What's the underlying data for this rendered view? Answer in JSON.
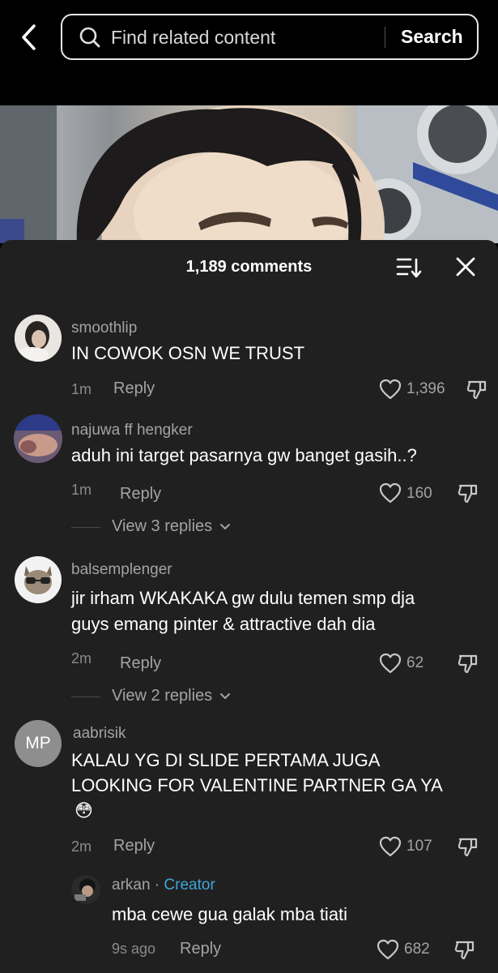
{
  "search": {
    "placeholder": "Find related content",
    "button": "Search"
  },
  "icons": {
    "back": "chevron-left-icon",
    "search": "magnifier-icon",
    "sort": "sort-icon",
    "close": "close-icon",
    "like": "heart-icon",
    "dislike": "thumbs-down-icon"
  },
  "sheet": {
    "title": "1,189 comments"
  },
  "comments": [
    {
      "username": "smoothlip",
      "text": "IN COWOK OSN WE TRUST",
      "time": "1m",
      "reply": "Reply",
      "likes": "1,396"
    },
    {
      "username": "najuwa ff hengker",
      "text": "aduh ini target pasarnya gw banget gasih..?",
      "time": "1m",
      "reply": "Reply",
      "likes": "160",
      "view_replies": "View 3 replies"
    },
    {
      "username": "balsemplenger",
      "text_line1": "jir irham WKAKAKA gw dulu temen smp dja",
      "text_line2": "guys emang pinter & attractive dah dia",
      "time": "2m",
      "reply": "Reply",
      "likes": "62",
      "view_replies": "View 2 replies"
    },
    {
      "username": "aabrisik",
      "avatar_initials": "MP",
      "text_line1": "KALAU YG DI SLIDE PERTAMA JUGA",
      "text_line2": "LOOKING FOR VALENTINE PARTNER GA YA",
      "emoji": "😳",
      "time": "2m",
      "reply": "Reply",
      "likes": "107"
    }
  ],
  "creator_reply": {
    "username": "arkan",
    "separator": " · ",
    "tag": "Creator",
    "text": "mba cewe gua galak mba tiati",
    "time": "9s ago",
    "reply": "Reply",
    "likes": "682"
  },
  "colors": {
    "sheet_bg": "#202020",
    "creator_accent": "#3fa6d8",
    "secondary_text": "#a3a3a3"
  }
}
